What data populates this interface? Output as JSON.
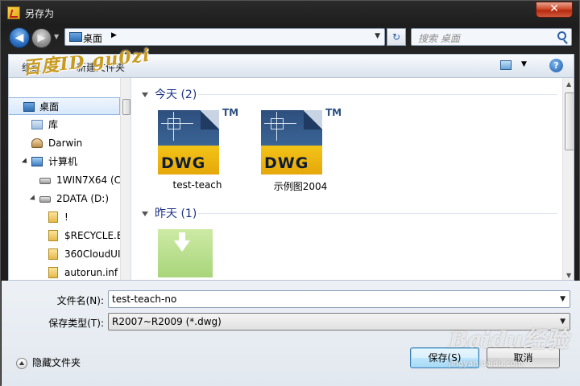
{
  "window": {
    "title": "另存为",
    "close": "✕"
  },
  "nav": {
    "back": "◀",
    "forward": "▶",
    "address": {
      "location": "桌面",
      "separator": "▶"
    },
    "refresh": "↻",
    "search_placeholder": "搜索 桌面"
  },
  "cmdbar": {
    "organize": "组织 ▾",
    "new_folder": "新建文件夹"
  },
  "watermark": "百度ID gu0zi",
  "sidebar": {
    "items": [
      {
        "label": "桌面",
        "icon": "desktop-icon"
      },
      {
        "label": "库",
        "icon": "library-icon"
      },
      {
        "label": "Darwin",
        "icon": "user-icon"
      },
      {
        "label": "计算机",
        "icon": "computer-icon"
      },
      {
        "label": "1WIN7X64 (C",
        "icon": "drive-icon"
      },
      {
        "label": "2DATA (D:)",
        "icon": "drive-icon"
      },
      {
        "label": "!",
        "icon": "folder-icon"
      },
      {
        "label": "$RECYCLE.B",
        "icon": "folder-icon"
      },
      {
        "label": "360CloudUI",
        "icon": "folder-icon"
      },
      {
        "label": "autorun.inf",
        "icon": "folder-icon"
      }
    ]
  },
  "groups": [
    {
      "label": "今天 (2)"
    },
    {
      "label": "昨天 (1)"
    }
  ],
  "files": [
    {
      "name": "test-teach",
      "icon": "dwg-file-icon",
      "badge": "DWG",
      "tm": "TM"
    },
    {
      "name": "示例图2004",
      "icon": "dwg-file-icon",
      "badge": "DWG",
      "tm": "TM"
    }
  ],
  "form": {
    "filename_label": "文件名(N):",
    "filename_value": "test-teach-no",
    "filetype_label": "保存类型(T):",
    "filetype_value": "R2007~R2009 (*.dwg)"
  },
  "footer": {
    "hide_folders": "隐藏文件夹",
    "save": "保存(S)",
    "cancel": "取消",
    "baidu_logo": "Baidu经验",
    "baidu_url": "jingyan.baidu.com"
  },
  "colors": {
    "accent": "#1e3287",
    "titlebar": "#1d1d1d",
    "close": "#cf4b2e"
  }
}
